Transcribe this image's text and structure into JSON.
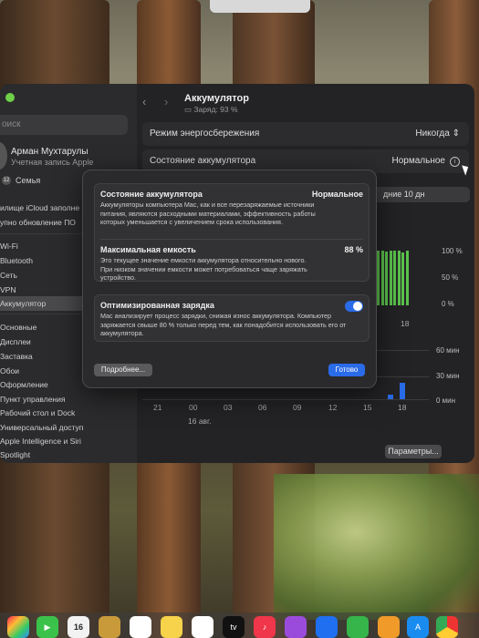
{
  "window": {
    "title": "Аккумулятор",
    "subtitle": "Заряд: 93 %"
  },
  "sidebar": {
    "search_placeholder": "оиск",
    "user_name": "Арман Мухтарулы",
    "user_sub": "Учетная запись Apple",
    "family_badge": "12",
    "family": "Семья",
    "items": [
      "илище iCloud заполне",
      "упно обновление ПО",
      "Wi-Fi",
      "Bluetooth",
      "Сеть",
      "VPN",
      "Аккумулятор",
      "Основные",
      "Дисплеи",
      "Заставка",
      "Обои",
      "Оформление",
      "Пункт управления",
      "Рабочий стол и Dock",
      "Универсальный доступ",
      "Apple Intelligence и Siri",
      "Spotlight"
    ]
  },
  "settings": {
    "low_power_label": "Режим энергосбережения",
    "low_power_value": "Никогда",
    "battery_health_label": "Состояние аккумулятора",
    "battery_health_value": "Нормальное",
    "range_button": "дние 10 дн",
    "params_button": "Параметры..."
  },
  "chart": {
    "pct_labels": [
      "100 %",
      "50 %",
      "0 %"
    ],
    "min_labels": [
      "60 мин",
      "30 мин",
      "0 мин"
    ],
    "x_labels": [
      "21",
      "00",
      "03",
      "06",
      "09",
      "12",
      "15",
      "18"
    ],
    "inner_x_label": "18",
    "date_label": "16 авг.",
    "green_bar_levels": [
      1.0,
      1.0,
      0.98,
      1.0,
      1.0,
      1.0,
      0.97,
      1.0
    ],
    "blue_bar_minutes": [
      5,
      18
    ]
  },
  "modal": {
    "health_title": "Состояние аккумулятора",
    "health_value": "Нормальное",
    "health_desc": "Аккумуляторы компьютера Mac, как и все перезаряжаемые источники питания, являются расходными материалами, эффективность работы которых уменьшается с увеличением срока использования.",
    "capacity_title": "Максимальная емкость",
    "capacity_value": "88 %",
    "capacity_desc": "Это текущее значение емкости аккумулятора относительно нового. При низком значении емкости может потребоваться чаще заряжать устройство.",
    "opt_title": "Оптимизированная зарядка",
    "opt_desc": "Mac анализирует процесс зарядки, снижая износ аккумулятора. Компьютер заряжается свыше 80 % только перед тем, как понадобится использовать его от аккумулятора.",
    "opt_enabled": true,
    "more_button": "Подробнее...",
    "done_button": "Готово"
  },
  "dock": {
    "calendar_day": "16",
    "tv_label": "tv"
  }
}
